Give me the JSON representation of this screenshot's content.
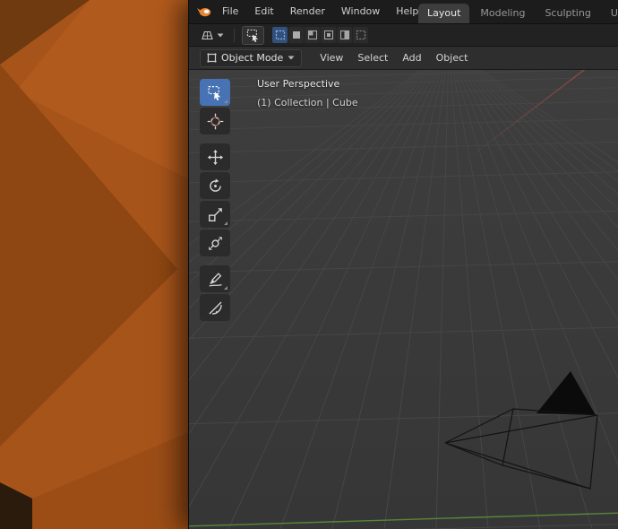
{
  "colors": {
    "accent_blue": "#4772b3",
    "header_bg": "#1c1c1c",
    "viewport_bg": "#3a3a3a",
    "axis_x_red": "#b5504a",
    "axis_y_green": "#5e9438",
    "wallpaper_orange": "#a7541a"
  },
  "topbar": {
    "menus": [
      "File",
      "Edit",
      "Render",
      "Window",
      "Help"
    ],
    "tabs": [
      "Layout",
      "Modeling",
      "Sculpting",
      "UV Ed"
    ],
    "active_tab": "Layout"
  },
  "toolheader": {
    "icon_names": [
      "editor-type-3d-viewport",
      "active-tool-select-box",
      "select-tweak",
      "select-box",
      "select-add",
      "select-subtract",
      "select-intersect",
      "select-lasso"
    ]
  },
  "viewheader": {
    "mode": "Object Mode",
    "menus": [
      "View",
      "Select",
      "Add",
      "Object"
    ]
  },
  "viewport": {
    "overlay": {
      "perspective": "User Perspective",
      "collection": "(1) Collection | Cube"
    },
    "toolbar_tools": [
      "select-box",
      "cursor-3d",
      "move",
      "rotate",
      "scale",
      "transform",
      "annotate",
      "measure"
    ],
    "objects": [
      "camera"
    ]
  }
}
